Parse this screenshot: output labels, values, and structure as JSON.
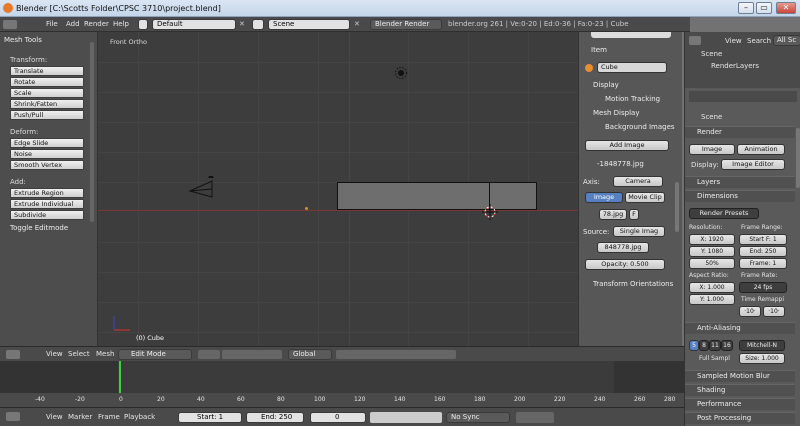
{
  "window": {
    "title": "Blender [C:\\Scotts Folder\\CPSC 3710\\project.blend]",
    "buttons": [
      "–",
      "▭",
      "✕"
    ]
  },
  "info_header": {
    "menus": [
      "File",
      "Add",
      "Render",
      "Help"
    ],
    "layout": "Default",
    "scene": "Scene",
    "engine": "Blender Render",
    "stats": "blender.org 261 | Ve:0-20 | Ed:0-36 | Fa:0-23 | Cube"
  },
  "tool_panel": {
    "title": "Mesh Tools",
    "groups": [
      {
        "label": "Transform:",
        "items": [
          "Translate",
          "Rotate",
          "Scale",
          "Shrink/Fatten",
          "Push/Pull"
        ]
      },
      {
        "label": "Deform:",
        "items": [
          "Edge Slide",
          "Noise",
          "Smooth Vertex"
        ]
      },
      {
        "label": "Add:",
        "items": [
          "Extrude Region",
          "Extrude Individual",
          "Subdivide"
        ]
      }
    ],
    "toggle": "Toggle Editmode"
  },
  "viewport": {
    "view_label": "Front Ortho",
    "object_label": "(0) Cube"
  },
  "props_panel": {
    "item_title": "Item",
    "object_name": "Cube",
    "sections": [
      "Display",
      "Motion Tracking",
      "Mesh Display",
      "Background Images"
    ],
    "add_image": "Add Image",
    "bg_image_name": "-1848778.jpg",
    "axis_label": "Axis:",
    "axis_value": "Camera",
    "tab_image": "Image",
    "tab_movie": "Movie Clip",
    "img_file": "78.jpg",
    "img_F": "F",
    "source_label": "Source:",
    "source_value": "Single Imag",
    "source_file": "848778.jpg",
    "opacity": "Opacity: 0.500",
    "transform_orient": "Transform Orientations"
  },
  "outliner": {
    "view": "View",
    "search": "Search",
    "all": "All Sc",
    "items": [
      "Scene",
      "RenderLayers"
    ]
  },
  "render_props": {
    "scene": "Scene",
    "render_title": "Render",
    "image_btn": "Image",
    "animation_btn": "Animation",
    "display_label": "Display:",
    "display_value": "Image Editor",
    "layers": "Layers",
    "dimensions": "Dimensions",
    "presets": "Render Presets",
    "resolution": "Resolution:",
    "res_x": "X: 1920",
    "res_y": "Y: 1080",
    "res_pct": "50%",
    "frame_range": "Frame Range:",
    "start": "Start F: 1",
    "end": "End: 250",
    "frame": "Frame: 1",
    "aspect": "Aspect Ratio:",
    "asp_x": "X: 1.000",
    "asp_y": "Y: 1.000",
    "frame_rate": "Frame Rate:",
    "fps": "24 fps",
    "remap": "Time Remappi",
    "remap_a": "·10·",
    "remap_b": "·10·",
    "aa": "Anti-Aliasing",
    "aa_levels": [
      "5",
      "8",
      "11",
      "16"
    ],
    "aa_filter": "Mitchell-N",
    "full_sample": "Full Sampl",
    "aa_size": "Size: 1.000",
    "sampled_motion": "Sampled Motion Blur",
    "shading": "Shading",
    "performance": "Performance",
    "post": "Post Processing"
  },
  "view3d_header": {
    "menus": [
      "View",
      "Select",
      "Mesh"
    ],
    "mode": "Edit Mode",
    "orientation": "Global"
  },
  "timeline": {
    "ticks": [
      "-40",
      "-20",
      "0",
      "20",
      "40",
      "60",
      "80",
      "100",
      "120",
      "140",
      "160",
      "180",
      "200",
      "220",
      "240",
      "260",
      "280"
    ],
    "menus": [
      "View",
      "Marker",
      "Frame",
      "Playback"
    ],
    "start": "Start: 1",
    "end": "End: 250",
    "current": "0",
    "sync": "No Sync"
  },
  "colors": {
    "viewport_bg": "#3d3d3d",
    "panel_bg": "#575757",
    "header_bg": "#4a4a4a",
    "accent_blue": "#5680c2",
    "frame_green": "#3fd03f"
  }
}
